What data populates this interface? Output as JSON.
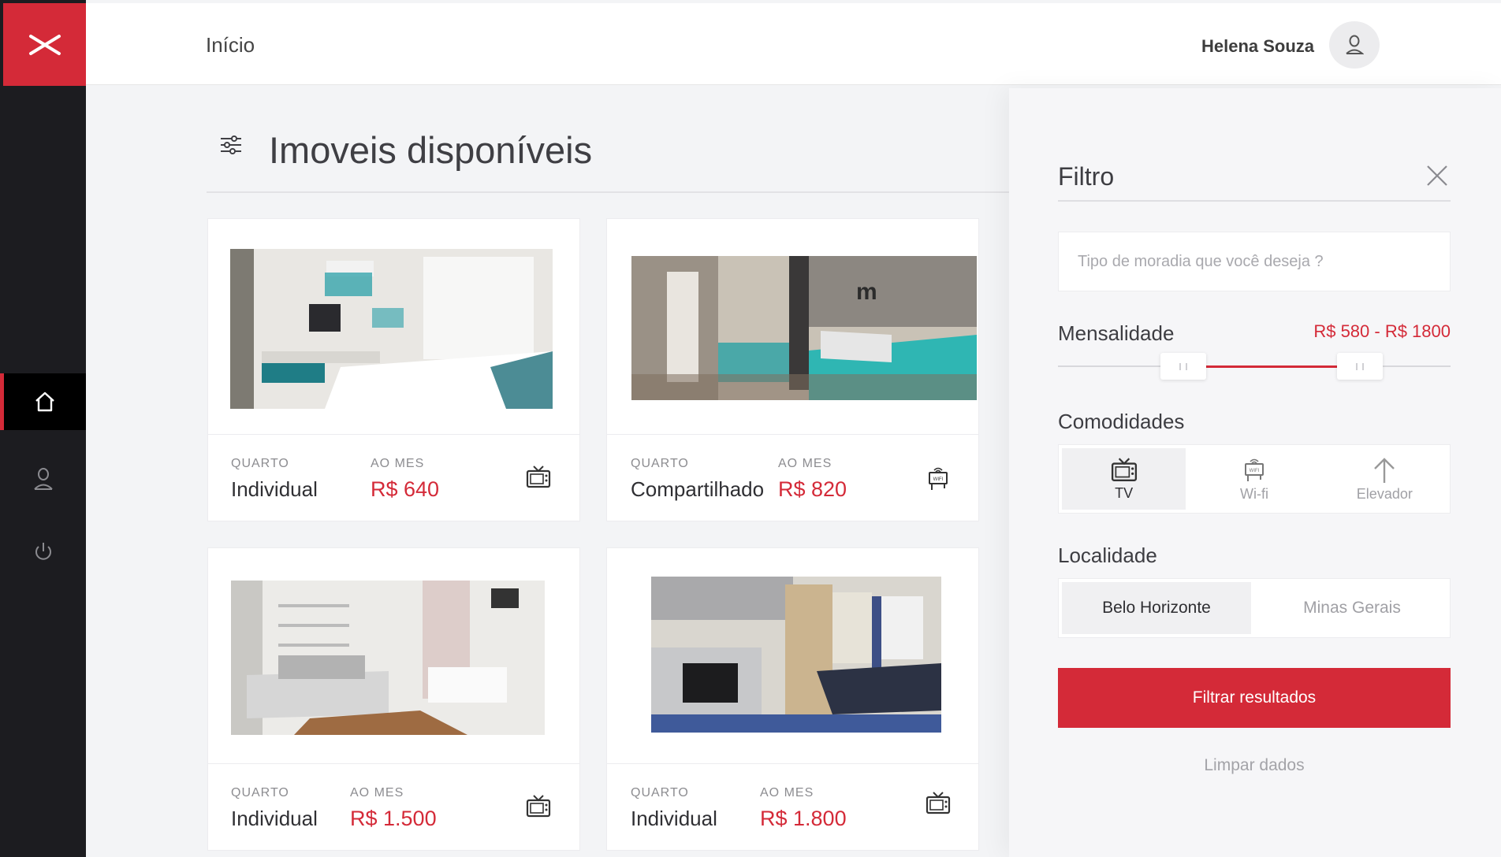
{
  "app": {
    "logo_icon": "brand-x-logo"
  },
  "sidebar": {
    "items": [
      {
        "name": "home",
        "icon": "home-icon",
        "active": true
      },
      {
        "name": "profile",
        "icon": "user-icon",
        "active": false
      },
      {
        "name": "logout",
        "icon": "power-icon",
        "active": false
      }
    ]
  },
  "header": {
    "title": "Início",
    "user_name": "Helena Souza",
    "avatar_icon": "user-icon"
  },
  "main": {
    "title": "Imoveis disponíveis",
    "listings": [
      {
        "category_label": "QUARTO",
        "category": "Individual",
        "price_label": "AO MES",
        "price": "R$ 640",
        "amenity_icon": "tv-icon"
      },
      {
        "category_label": "QUARTO",
        "category": "Compartilhado",
        "price_label": "AO MES",
        "price": "R$ 820",
        "amenity_icon": "wifi-icon"
      },
      {
        "category_label": "QUARTO",
        "category": "Individual",
        "price_label": "AO MES",
        "price": "R$ 1.500",
        "amenity_icon": "tv-icon"
      },
      {
        "category_label": "QUARTO",
        "category": "Individual",
        "price_label": "AO MES",
        "price": "R$ 1.800",
        "amenity_icon": "tv-icon"
      }
    ]
  },
  "filter": {
    "title": "Filtro",
    "search_placeholder": "Tipo de moradia que você deseja ?",
    "price": {
      "label": "Mensalidade",
      "range_text": "R$ 580 - R$ 1800",
      "min_fraction": 0.32,
      "max_fraction": 0.77
    },
    "amenities": {
      "label": "Comodidades",
      "options": [
        {
          "label": "TV",
          "icon": "tv-icon",
          "selected": true
        },
        {
          "label": "Wi-fi",
          "icon": "wifi-icon",
          "selected": false
        },
        {
          "label": "Elevador",
          "icon": "arrow-up-icon",
          "selected": false
        }
      ]
    },
    "location": {
      "label": "Localidade",
      "options": [
        {
          "label": "Belo Horizonte",
          "selected": true
        },
        {
          "label": "Minas Gerais",
          "selected": false
        }
      ]
    },
    "submit_label": "Filtrar resultados",
    "clear_label": "Limpar dados"
  },
  "colors": {
    "accent": "#d42a38",
    "sidebar": "#1c1c20",
    "background": "#f3f4f6"
  }
}
